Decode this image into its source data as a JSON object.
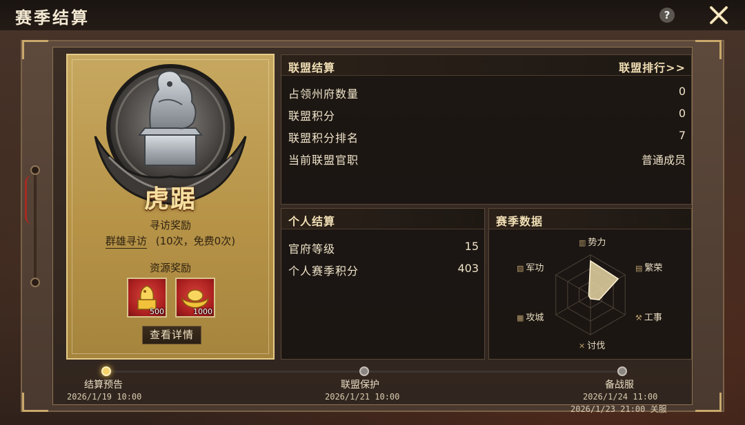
{
  "header": {
    "title": "赛季结算",
    "help_icon": "?"
  },
  "rank": {
    "name": "虎踞",
    "visit_reward_title": "寻访奖励",
    "visit_link": "群雄寻访",
    "visit_note": "(10次，免费0次)",
    "resource_title": "资源奖励",
    "rewards": [
      {
        "icon": "gold-seal-icon",
        "count": "500"
      },
      {
        "icon": "gold-ingot-icon",
        "count": "1000"
      }
    ],
    "details_button": "查看详情"
  },
  "alliance": {
    "title": "联盟结算",
    "ranking_link": "联盟排行>>",
    "rows": [
      {
        "label": "占领州府数量",
        "value": "0"
      },
      {
        "label": "联盟积分",
        "value": "0"
      },
      {
        "label": "联盟积分排名",
        "value": "7"
      },
      {
        "label": "当前联盟官职",
        "value": "普通成员"
      }
    ]
  },
  "personal": {
    "title": "个人结算",
    "rows": [
      {
        "label": "官府等级",
        "value": "15"
      },
      {
        "label": "个人赛季积分",
        "value": "403"
      }
    ]
  },
  "season": {
    "title": "赛季数据",
    "axes": [
      "势力",
      "繁荣",
      "工事",
      "讨伐",
      "攻城",
      "军功"
    ],
    "values": [
      0.85,
      0.8,
      0.25,
      0.1,
      0.05,
      0.05
    ]
  },
  "timeline": {
    "stages": [
      {
        "label": "结算预告",
        "date": "2026/1/19 10:00",
        "active": true
      },
      {
        "label": "联盟保护",
        "date": "2026/1/21 10:00",
        "active": false
      },
      {
        "label": "备战服",
        "date": "2026/1/24 11:00",
        "active": false
      }
    ],
    "close_note": "2026/1/23 21:00 关服"
  },
  "colors": {
    "accent": "#f1dfb5",
    "card_gold": "#b69347",
    "reward_red": "#a81e1e",
    "radar_fill": "#e8d6a6"
  }
}
